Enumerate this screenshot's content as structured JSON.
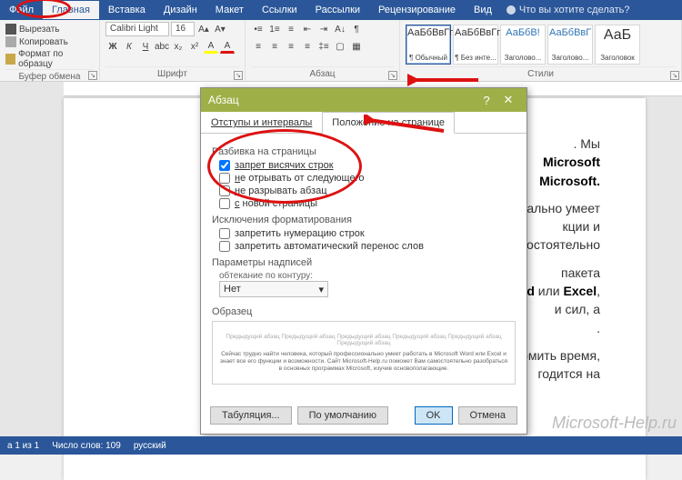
{
  "ribbon": {
    "tabs": [
      "Файл",
      "Главная",
      "Вставка",
      "Дизайн",
      "Макет",
      "Ссылки",
      "Рассылки",
      "Рецензирование",
      "Вид"
    ],
    "tell_me": "Что вы хотите сделать?",
    "clipboard": {
      "cut": "Вырезать",
      "copy": "Копировать",
      "paint": "Формат по образцу",
      "title": "Буфер обмена"
    },
    "font": {
      "name": "Calibri Light",
      "size": "16",
      "title": "Шрифт"
    },
    "para": {
      "title": "Абзац"
    },
    "styles": {
      "title": "Стили",
      "items": [
        {
          "sample": "АаБбВвГг,",
          "name": "¶ Обычный"
        },
        {
          "sample": "АаБбВвГг,",
          "name": "¶ Без инте..."
        },
        {
          "sample": "АаБбВ!",
          "name": "Заголово..."
        },
        {
          "sample": "АаБбВвГ",
          "name": "Заголово..."
        },
        {
          "sample": "АаБ",
          "name": "Заголовок"
        }
      ]
    }
  },
  "doc": {
    "line1a": ". Мы",
    "line2b": "Microsoft",
    "line3b": "Microsoft.",
    "line4": "ально умеет",
    "line5": "кции и",
    "line6": "остоятельно",
    "line7": "пакета",
    "line8a": "rd",
    "line8b": " или ",
    "line8c": "Excel",
    "line8d": ",",
    "line9": "и сил, а",
    "line10": ".",
    "line11": "омить время,",
    "line12": "годится на"
  },
  "dialog": {
    "title": "Абзац",
    "tab1": "Отступы и интервалы",
    "tab2": "Положение на странице",
    "sect1": "Разбивка на страницы",
    "c1": "запрет висячих строк",
    "c2": "не отрывать от следующего",
    "c3": "не разрывать абзац",
    "c4": "с новой страницы",
    "sect2": "Исключения форматирования",
    "c5": "запретить нумерацию строк",
    "c6": "запретить автоматический перенос слов",
    "sect3": "Параметры надписей",
    "wrap_label": "обтекание по контуру:",
    "wrap_value": "Нет",
    "sample": "Образец",
    "prev1": "Предыдущий абзац Предыдущий абзац Предыдущий абзац Предыдущий абзац Предыдущий абзац Предыдущий абзац",
    "prev2": "Сейчас трудно найти человека, который профессионально умеет работать в Microsoft Word или Excel и знает все его функции и возможности. Сайт Microsoft-Help.ru поможет Вам самостоятельно разобраться в основных программах Microsoft, изучив основополагающие.",
    "btn_tab": "Табуляция...",
    "btn_def": "По умолчанию",
    "btn_ok": "OK",
    "btn_cancel": "Отмена"
  },
  "status": {
    "page": "а 1 из 1",
    "words": "Число слов: 109",
    "lang": "русский"
  },
  "watermark": "Microsoft-Help.ru"
}
